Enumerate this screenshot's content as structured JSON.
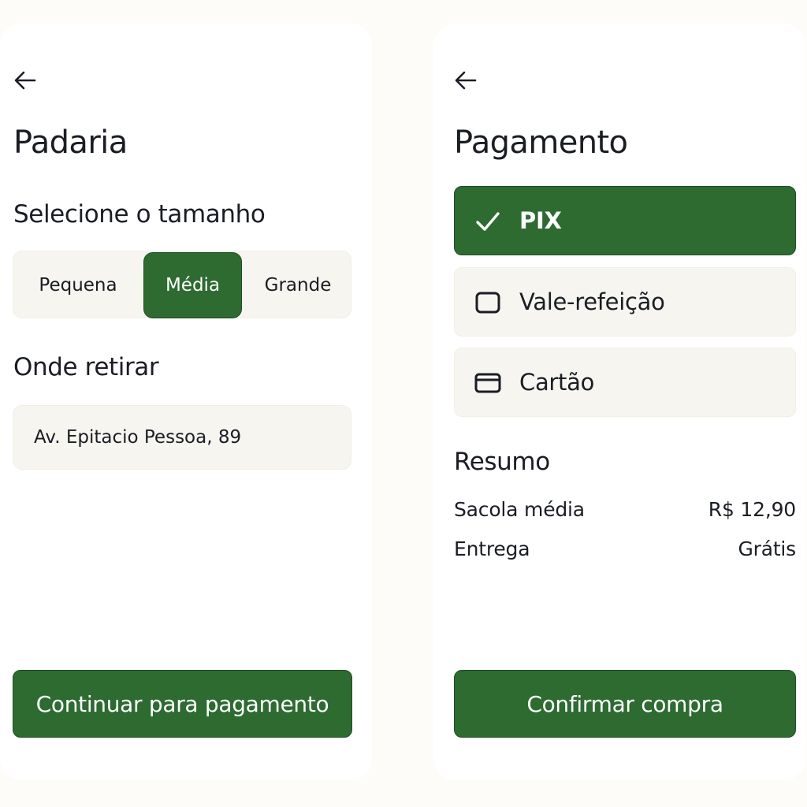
{
  "left_screen": {
    "title": "Padaria",
    "size_heading": "Selecione o tamanho",
    "sizes": [
      {
        "label": "Pequena",
        "selected": false
      },
      {
        "label": "Média",
        "selected": true
      },
      {
        "label": "Grande",
        "selected": false
      }
    ],
    "pickup_heading": "Onde retirar",
    "pickup_address": "Av. Epitacio Pessoa, 89",
    "continue_button": "Continuar para pagamento",
    "back_icon": "arrow-left-icon"
  },
  "right_screen": {
    "title": "Pagamento",
    "payment_options": [
      {
        "label": "PIX",
        "icon": "check-icon",
        "selected": true
      },
      {
        "label": "Vale-refeição",
        "icon": "checkbox-icon",
        "selected": false
      },
      {
        "label": "Cartão",
        "icon": "credit-card-icon",
        "selected": false
      }
    ],
    "summary_heading": "Resumo",
    "summary": [
      {
        "label": "Sacola média",
        "value": "R$ 12,90"
      },
      {
        "label": "Entrega",
        "value": "Grátis"
      }
    ],
    "confirm_button": "Confirmar compra",
    "back_icon": "arrow-left-icon"
  },
  "colors": {
    "accent": "#2d6b31",
    "field_background": "#f7f5ef",
    "text": "#1a1d24",
    "page_background": "#fdfcf8"
  }
}
